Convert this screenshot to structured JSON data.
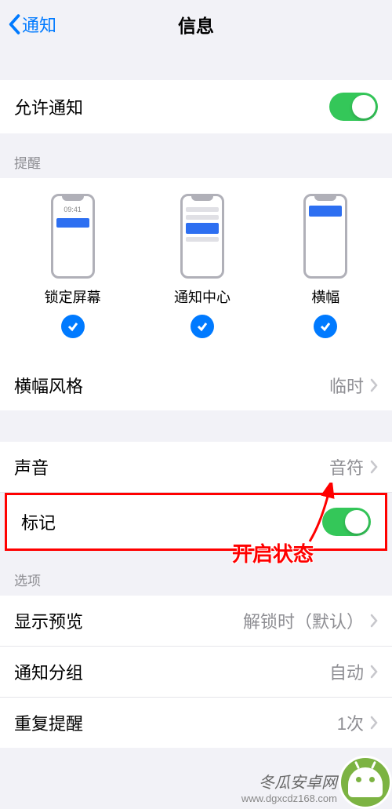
{
  "header": {
    "back_label": "通知",
    "title": "信息"
  },
  "allow_notifications": {
    "label": "允许通知",
    "enabled": true
  },
  "alerts": {
    "section_header": "提醒",
    "lock_time": "09:41",
    "options": [
      {
        "label": "锁定屏幕",
        "checked": true
      },
      {
        "label": "通知中心",
        "checked": true
      },
      {
        "label": "横幅",
        "checked": true
      }
    ]
  },
  "banner_style": {
    "label": "横幅风格",
    "value": "临时"
  },
  "sounds": {
    "label": "声音",
    "value": "音符"
  },
  "badges": {
    "label": "标记",
    "enabled": true
  },
  "options": {
    "section_header": "选项",
    "show_previews": {
      "label": "显示预览",
      "value": "解锁时（默认）"
    },
    "grouping": {
      "label": "通知分组",
      "value": "自动"
    },
    "repeat": {
      "label": "重复提醒",
      "value": "1次"
    }
  },
  "annotation": {
    "text": "开启状态"
  },
  "watermark": {
    "name": "冬瓜安卓网",
    "url": "www.dgxcdz168.com"
  }
}
